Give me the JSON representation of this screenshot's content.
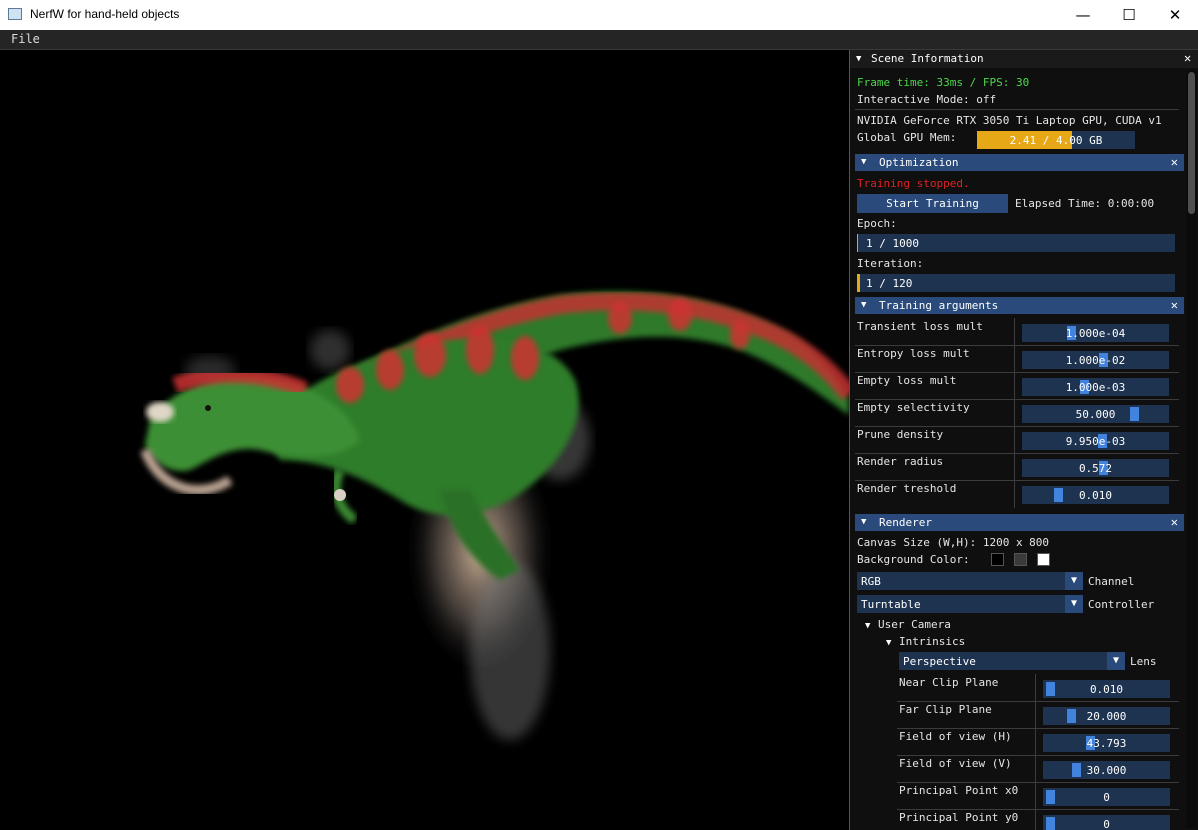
{
  "window": {
    "title": "NerfW for hand-held objects",
    "minimize": "—",
    "maximize": "☐",
    "close": "✕"
  },
  "menubar": {
    "file": "File"
  },
  "panel": {
    "title": "Scene Information",
    "frame_time": "Frame time: 33ms / FPS: 30",
    "interactive_mode": "Interactive Mode: off",
    "gpu_name": "NVIDIA GeForce RTX 3050 Ti Laptop GPU, CUDA v1",
    "gpu_mem_label": "Global GPU Mem:",
    "gpu_mem_value": "2.41 / 4.00 GB",
    "gpu_mem_fraction": 0.6025,
    "colors": {
      "accent": "#e6a817",
      "frame": "#1d3350",
      "header": "#294a7a",
      "ok": "#4cd94c",
      "error": "#e02020"
    }
  },
  "optimization": {
    "title": "Optimization",
    "status": "Training stopped.",
    "start_button": "Start Training",
    "elapsed": "Elapsed Time: 0:00:00",
    "epoch_label": "Epoch:",
    "epoch_value": "1 / 1000",
    "epoch_fraction": 0.001,
    "iteration_label": "Iteration:",
    "iteration_value": "1 / 120",
    "iteration_fraction": 0.008
  },
  "training_args": {
    "title": "Training arguments",
    "rows": [
      {
        "label": "Transient loss mult",
        "value": "1.000e-04"
      },
      {
        "label": "Entropy loss mult",
        "value": "1.000e-02"
      },
      {
        "label": "Empty loss mult",
        "value": "1.000e-03"
      },
      {
        "label": "Empty selectivity",
        "value": "50.000"
      },
      {
        "label": "Prune density",
        "value": "9.950e-03"
      },
      {
        "label": "Render radius",
        "value": "0.572"
      },
      {
        "label": "Render treshold",
        "value": "0.010"
      }
    ]
  },
  "renderer": {
    "title": "Renderer",
    "canvas_size": "Canvas Size (W,H): 1200 x 800",
    "background_label": "Background Color:",
    "background_colors": [
      "#000000",
      "#3a3a3a",
      "#ffffff"
    ],
    "channel_value": "RGB",
    "channel_label": "Channel",
    "controller_value": "Turntable",
    "controller_label": "Controller",
    "user_camera": "User Camera",
    "intrinsics": "Intrinsics",
    "lens_value": "Perspective",
    "lens_label": "Lens",
    "intrinsic_rows": [
      {
        "label": "Near Clip Plane",
        "value": "0.010"
      },
      {
        "label": "Far Clip Plane",
        "value": "20.000"
      },
      {
        "label": "Field of view (H)",
        "value": "43.793"
      },
      {
        "label": "Field of view (V)",
        "value": "30.000"
      },
      {
        "label": "Principal Point x0",
        "value": "0"
      },
      {
        "label": "Principal Point y0",
        "value": "0"
      }
    ]
  }
}
